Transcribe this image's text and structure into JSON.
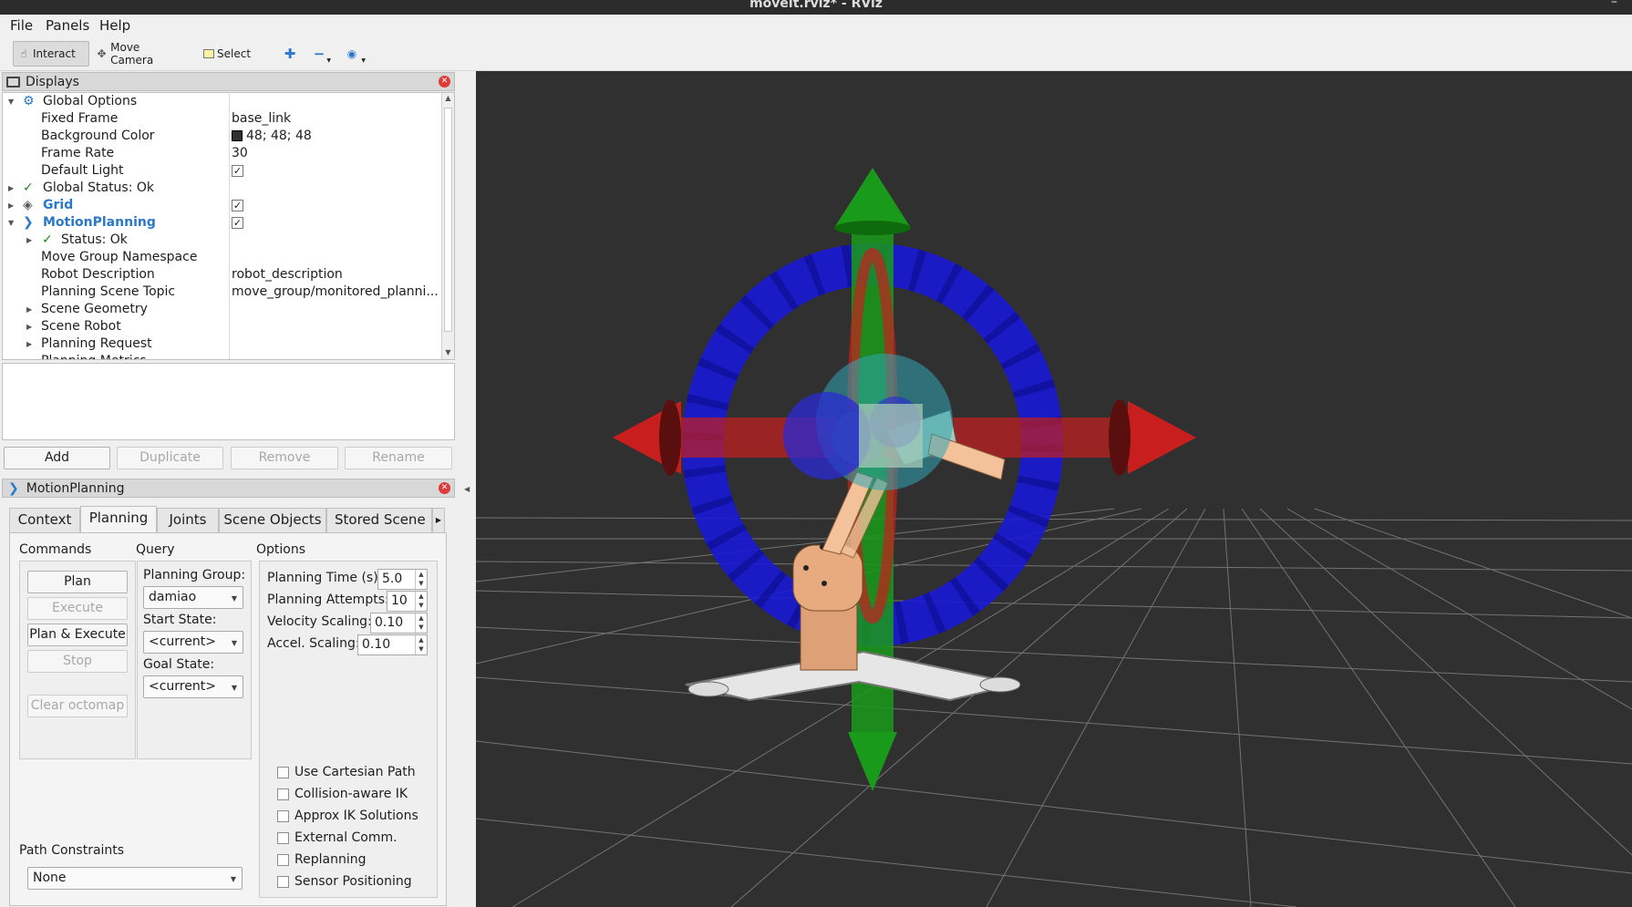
{
  "window": {
    "title": "moveit.rviz* - RViz"
  },
  "menu": [
    "File",
    "Panels",
    "Help"
  ],
  "toolbar": {
    "interact": "Interact",
    "move_camera": "Move Camera",
    "select": "Select"
  },
  "displays": {
    "title": "Displays",
    "rows": [
      {
        "label": "Global Options",
        "value": ""
      },
      {
        "label": "Fixed Frame",
        "value": "base_link"
      },
      {
        "label": "Background Color",
        "value": "48; 48; 48"
      },
      {
        "label": "Frame Rate",
        "value": "30"
      },
      {
        "label": "Default Light",
        "value": ""
      },
      {
        "label": "Global Status: Ok",
        "value": ""
      },
      {
        "label": "Grid",
        "value": ""
      },
      {
        "label": "MotionPlanning",
        "value": ""
      },
      {
        "label": "Status: Ok",
        "value": ""
      },
      {
        "label": "Move Group Namespace",
        "value": ""
      },
      {
        "label": "Robot Description",
        "value": "robot_description"
      },
      {
        "label": "Planning Scene Topic",
        "value": "move_group/monitored_planni..."
      },
      {
        "label": "Scene Geometry",
        "value": ""
      },
      {
        "label": "Scene Robot",
        "value": ""
      },
      {
        "label": "Planning Request",
        "value": ""
      },
      {
        "label": "Planning Metrics",
        "value": ""
      }
    ],
    "check_mark": "✓",
    "buttons": {
      "add": "Add",
      "duplicate": "Duplicate",
      "remove": "Remove",
      "rename": "Rename"
    }
  },
  "motion_planning": {
    "title": "MotionPlanning",
    "tabs": [
      "Context",
      "Planning",
      "Joints",
      "Scene Objects",
      "Stored Scene"
    ],
    "selected_tab": "Planning",
    "commands": {
      "label": "Commands",
      "plan": "Plan",
      "execute": "Execute",
      "plan_execute": "Plan & Execute",
      "stop": "Stop",
      "clear_octomap": "Clear octomap"
    },
    "query": {
      "label": "Query",
      "planning_group_label": "Planning Group:",
      "planning_group": "damiao",
      "start_state_label": "Start State:",
      "start_state": "<current>",
      "goal_state_label": "Goal State:",
      "goal_state": "<current>"
    },
    "options": {
      "label": "Options",
      "planning_time_label": "Planning Time (s):",
      "planning_time": "5.0",
      "planning_attempts_label": "Planning Attempts:",
      "planning_attempts": "10",
      "velocity_scaling_label": "Velocity Scaling:",
      "velocity_scaling": "0.10",
      "accel_scaling_label": "Accel. Scaling:",
      "accel_scaling": "0.10",
      "checkboxes": [
        {
          "label": "Use Cartesian Path",
          "checked": false
        },
        {
          "label": "Collision-aware IK",
          "checked": false
        },
        {
          "label": "Approx IK Solutions",
          "checked": false
        },
        {
          "label": "External Comm.",
          "checked": false
        },
        {
          "label": "Replanning",
          "checked": false
        },
        {
          "label": "Sensor Positioning",
          "checked": false
        }
      ]
    },
    "path_constraints": {
      "label": "Path Constraints",
      "value": "None"
    }
  },
  "colors": {
    "viewport_bg": "#303030",
    "x_axis": "#c81e1e",
    "y_axis": "#1a9a1a",
    "ring": "#1a1ad6",
    "accent_blue": "#2a78c9"
  }
}
